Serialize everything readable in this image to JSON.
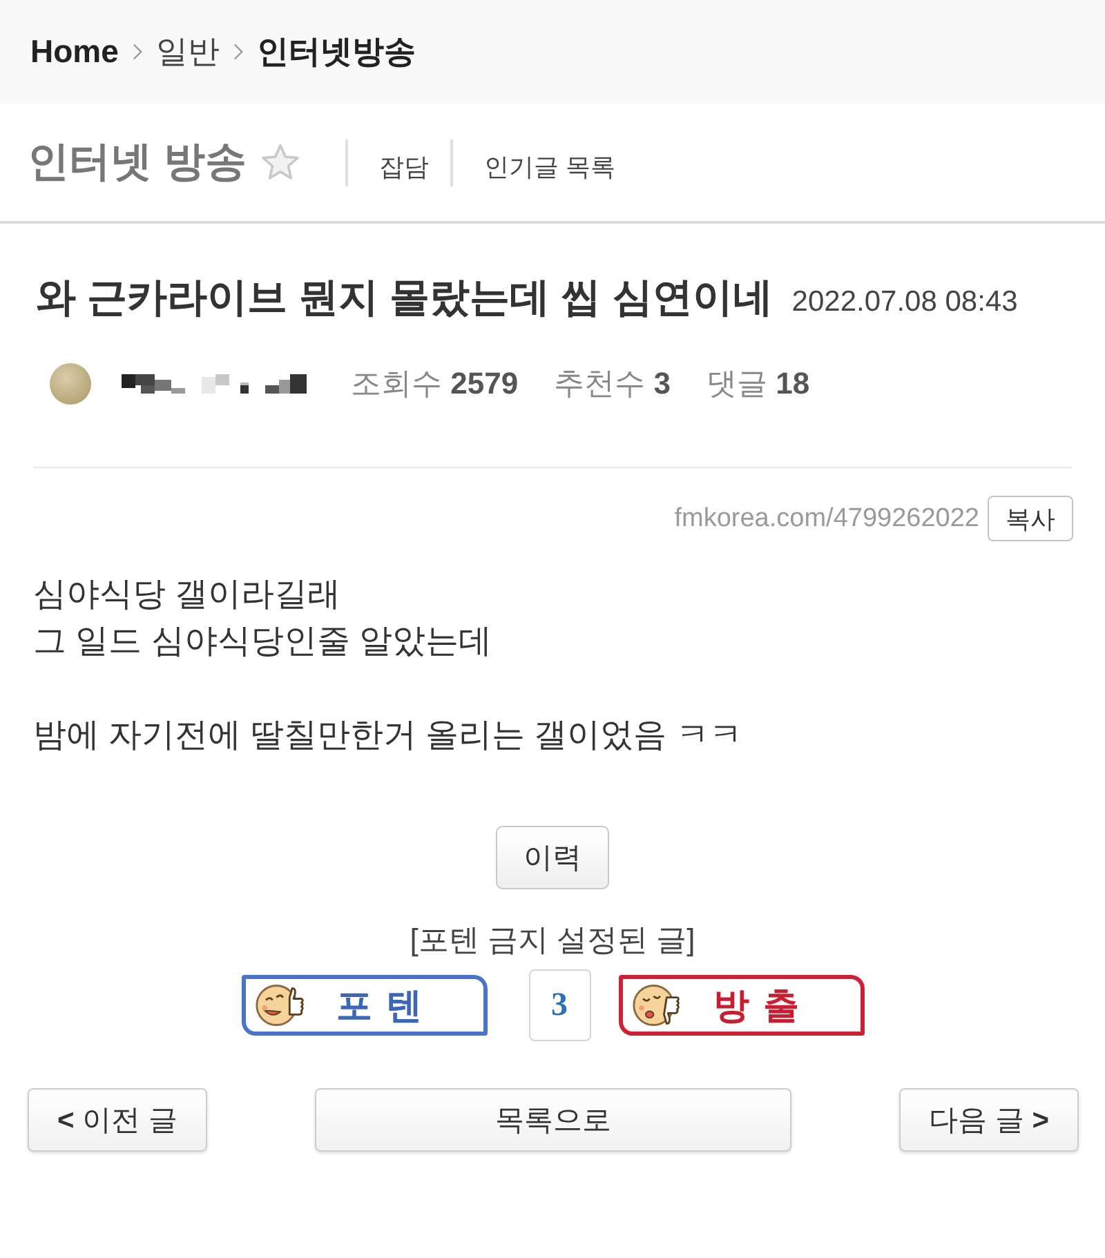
{
  "breadcrumb": [
    {
      "label": "Home",
      "bold": true
    },
    {
      "label": "일반",
      "bold": false
    },
    {
      "label": "인터넷방송",
      "bold": true
    }
  ],
  "board": {
    "title": "인터넷 방송",
    "favorited": false,
    "links": [
      "잡담",
      "인기글 목록"
    ]
  },
  "post": {
    "title": "와 근카라이브 뭔지 몰랐는데 씹 심연이네",
    "date": "2022.07.08 08:43",
    "stats": [
      {
        "label": "조회수",
        "value": "2579"
      },
      {
        "label": "추천수",
        "value": "3"
      },
      {
        "label": "댓글",
        "value": "18"
      }
    ],
    "url": "fmkorea.com/4799262022",
    "copy_button": "복사",
    "paragraphs": [
      {
        "lines": [
          "심야식당 갤이라길래",
          "그 일드 심야식당인줄 알았는데"
        ]
      },
      {
        "lines": [
          "밤에 자기전에 딸칠만한거 올리는 갤이었음 ㅋㅋ"
        ]
      }
    ],
    "history_button": "이력"
  },
  "vote": {
    "notice": "[포텐 금지 설정된 글]",
    "items": [
      {
        "kind": "up",
        "label": "포텐"
      },
      {
        "kind": "count",
        "label": "3"
      },
      {
        "kind": "down",
        "label": "방출"
      }
    ]
  },
  "nav": {
    "prev": "**<** 이전 글",
    "list": "목록으로",
    "next": "다음 글 **>**"
  }
}
